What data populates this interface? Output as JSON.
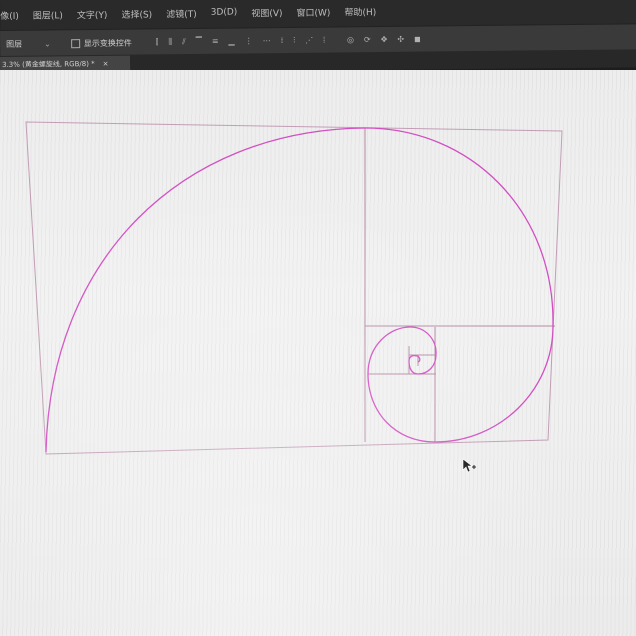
{
  "menubar": {
    "items": [
      "像(I)",
      "图层(L)",
      "文字(Y)",
      "选择(S)",
      "滤镜(T)",
      "3D(D)",
      "视图(V)",
      "窗口(W)",
      "帮助(H)"
    ]
  },
  "options": {
    "select_value": "图层",
    "checkbox_label": "显示变换控件"
  },
  "document_tab": {
    "title": "3.3% (黄金螺旋线, RGB/8) *",
    "close_glyph": "×"
  },
  "colors": {
    "guide": "#b68aa6",
    "spiral": "#d24fc3"
  },
  "icons": [
    "align-left-icon",
    "align-center-icon",
    "align-right-icon",
    "align-top-icon",
    "align-middle-icon",
    "align-bottom-icon",
    "distribute-icon",
    "3d-mode-icon",
    "cursor-arrow-icon"
  ]
}
